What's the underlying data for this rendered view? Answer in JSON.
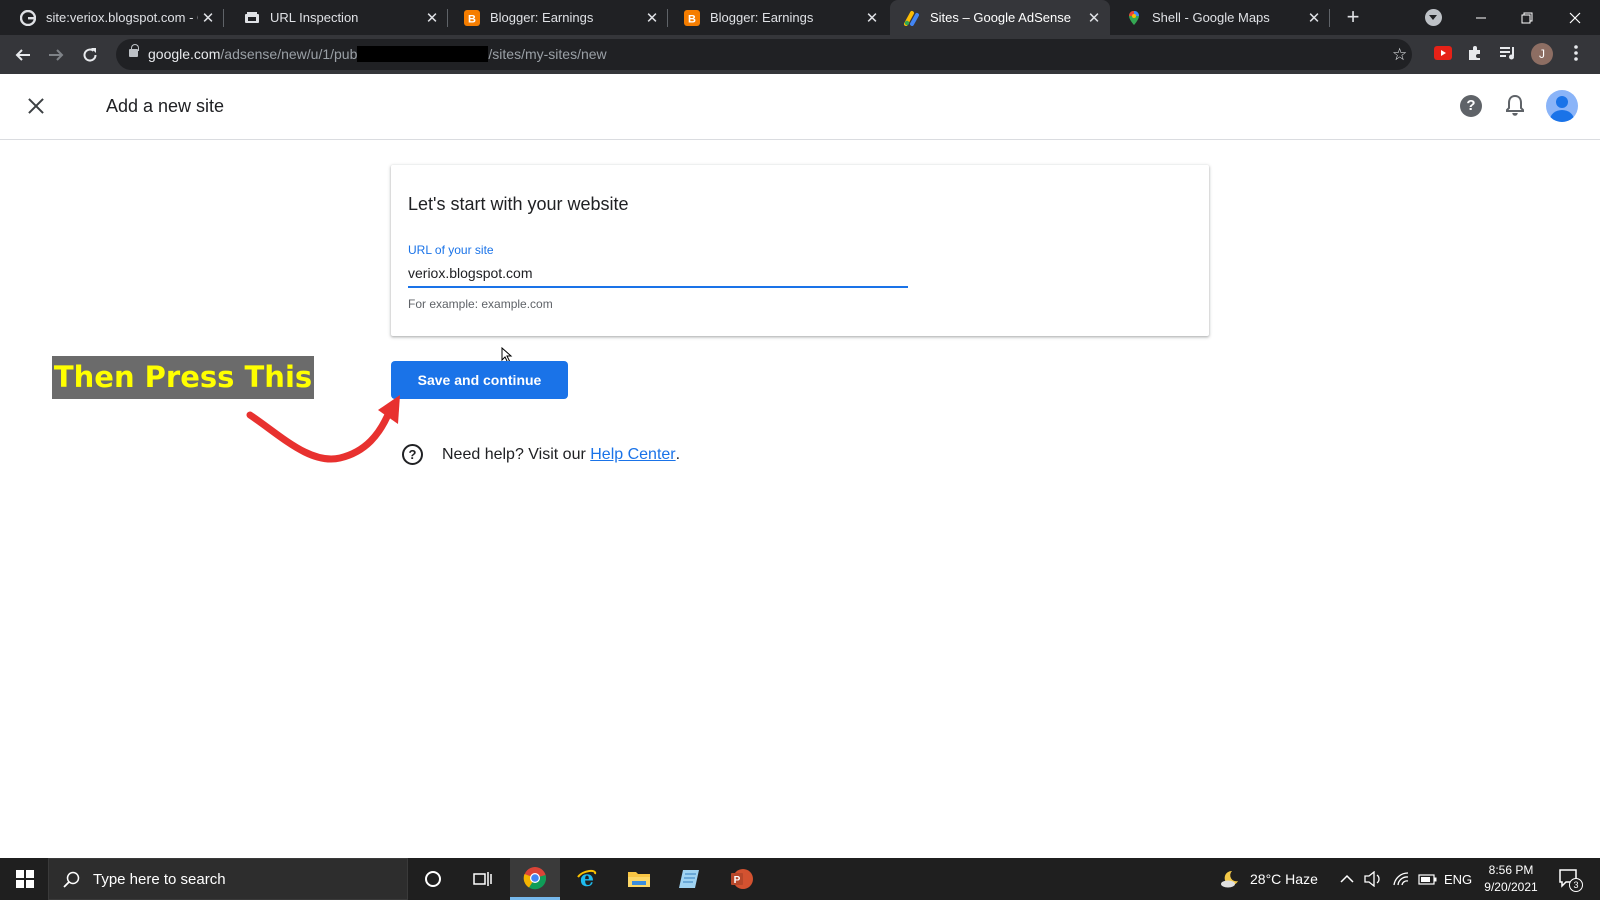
{
  "browser": {
    "tabs": [
      {
        "title": "site:veriox.blogspot.com - G",
        "icon": "google-icon"
      },
      {
        "title": "URL Inspection",
        "icon": "search-console-icon"
      },
      {
        "title": "Blogger: Earnings",
        "icon": "blogger-icon"
      },
      {
        "title": "Blogger: Earnings",
        "icon": "blogger-icon"
      },
      {
        "title": "Sites – Google AdSense",
        "icon": "adsense-icon",
        "active": true
      },
      {
        "title": "Shell - Google Maps",
        "icon": "maps-icon"
      }
    ],
    "close_glyph": "✕",
    "url_host": "google.com",
    "url_path_start": "/adsense/new/u/1/pub",
    "url_path_end": "/sites/my-sites/new",
    "profile_initial": "J"
  },
  "app": {
    "header_title": "Add a new site"
  },
  "card": {
    "title": "Let's start with your website",
    "field_label": "URL of your site",
    "field_value": "veriox.blogspot.com",
    "hint": "For example: example.com"
  },
  "save_button": "Save and continue",
  "help": {
    "text": "Need help? Visit our ",
    "link": "Help Center",
    "suffix": "."
  },
  "annotation": {
    "text": "Then Press This"
  },
  "taskbar": {
    "search_placeholder": "Type here to search",
    "weather": "28°C  Haze",
    "language": "ENG",
    "time": "8:56 PM",
    "date": "9/20/2021",
    "notification_count": "3"
  },
  "colors": {
    "accent": "#1a73e8",
    "annotation_text": "#ffff00",
    "annotation_bg": "#6b6b6b",
    "arrow": "#e8312f"
  }
}
